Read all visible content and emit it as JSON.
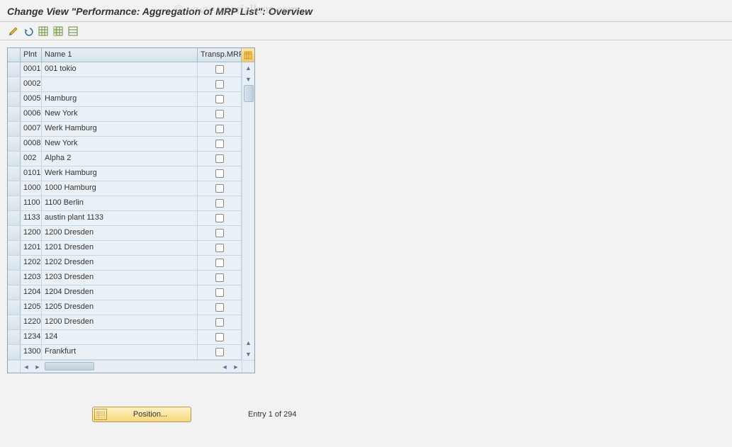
{
  "title": "Change View \"Performance: Aggregation of MRP List\": Overview",
  "watermark": "© www.tutorialkart.com",
  "toolbar": {
    "btn1": "change-entries",
    "btn2": "undo",
    "btn3": "select-all",
    "btn4": "save",
    "btn5": "deselect-all"
  },
  "table": {
    "headers": {
      "plnt": "Plnt",
      "name1": "Name 1",
      "transp": "Transp.MRP"
    },
    "rows": [
      {
        "plnt": "0001",
        "name1": "001 tokio"
      },
      {
        "plnt": "0002",
        "name1": ""
      },
      {
        "plnt": "0005",
        "name1": "Hamburg"
      },
      {
        "plnt": "0006",
        "name1": "New York"
      },
      {
        "plnt": "0007",
        "name1": "Werk Hamburg"
      },
      {
        "plnt": "0008",
        "name1": "New York"
      },
      {
        "plnt": "002",
        "name1": "Alpha 2"
      },
      {
        "plnt": "0101",
        "name1": "Werk Hamburg"
      },
      {
        "plnt": "1000",
        "name1": "1000 Hamburg"
      },
      {
        "plnt": "1100",
        "name1": "1100 Berlin"
      },
      {
        "plnt": "1133",
        "name1": "austin plant 1133"
      },
      {
        "plnt": "1200",
        "name1": "1200 Dresden"
      },
      {
        "plnt": "1201",
        "name1": "1201 Dresden"
      },
      {
        "plnt": "1202",
        "name1": "1202 Dresden"
      },
      {
        "plnt": "1203",
        "name1": "1203 Dresden"
      },
      {
        "plnt": "1204",
        "name1": "1204 Dresden"
      },
      {
        "plnt": "1205",
        "name1": "1205 Dresden"
      },
      {
        "plnt": "1220",
        "name1": "1200 Dresden"
      },
      {
        "plnt": "1234",
        "name1": "124"
      },
      {
        "plnt": "1300",
        "name1": "Frankfurt"
      }
    ]
  },
  "footer": {
    "position_label": "Position...",
    "entry_text": "Entry 1 of 294"
  }
}
